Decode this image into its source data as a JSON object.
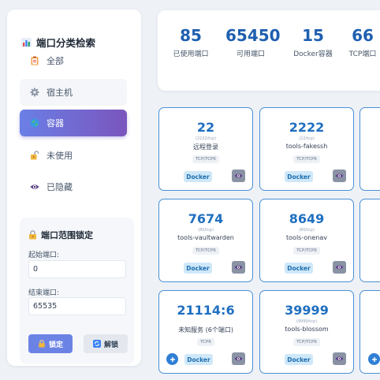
{
  "sidebar": {
    "title": "端口分类检索",
    "items": [
      {
        "label": "全部",
        "icon": "clipboard-icon",
        "state": "normal"
      },
      {
        "label": "宿主机",
        "icon": "gear-icon",
        "state": "hover"
      },
      {
        "label": "容器",
        "icon": "globe-icon",
        "state": "active"
      },
      {
        "label": "未使用",
        "icon": "unlock-icon",
        "state": "normal"
      },
      {
        "label": "已隐藏",
        "icon": "eye-icon",
        "state": "normal"
      }
    ]
  },
  "range": {
    "title": "端口范围锁定",
    "start_label": "起始端口:",
    "start_value": "0",
    "end_label": "结束端口:",
    "end_value": "65535",
    "lock_label": "锁定",
    "unlock_label": "解锁"
  },
  "stats": [
    {
      "value": "85",
      "label": "已使用端口"
    },
    {
      "value": "65450",
      "label": "可用端口"
    },
    {
      "value": "15",
      "label": "Docker容器"
    },
    {
      "value": "66",
      "label": "TCP端口"
    }
  ],
  "cards": [
    {
      "port": "22",
      "mapping": "(2222/tcp)",
      "name": "远程登录",
      "proto": "TCP/TCP6",
      "tag": "Docker",
      "has_add": false
    },
    {
      "port": "2222",
      "mapping": "(22/tcp)",
      "name": "tools-fakessh",
      "proto": "TCP/TCP6",
      "tag": "Docker",
      "has_add": false
    },
    {
      "port": "7674",
      "mapping": "(80/tcp)",
      "name": "tools-vaultwarden",
      "proto": "TCP/TCP6",
      "tag": "Docker",
      "has_add": false
    },
    {
      "port": "8649",
      "mapping": "(80/tcp)",
      "name": "tools-onenav",
      "proto": "TCP/TCP6",
      "tag": "Docker",
      "has_add": false
    },
    {
      "port": "21114:6",
      "mapping": "",
      "name": "未知服务 (6个端口)",
      "proto": "TCP6",
      "tag": "Docker",
      "has_add": true
    },
    {
      "port": "39999",
      "mapping": "(9999/tcp)",
      "name": "tools-blossom",
      "proto": "TCP/TCP6",
      "tag": "Docker",
      "has_add": false
    }
  ],
  "colors": {
    "accent": "#1f6fc0",
    "active_start": "#6a7fe6",
    "active_end": "#7a55bd",
    "card_border": "#4a8fd6"
  }
}
